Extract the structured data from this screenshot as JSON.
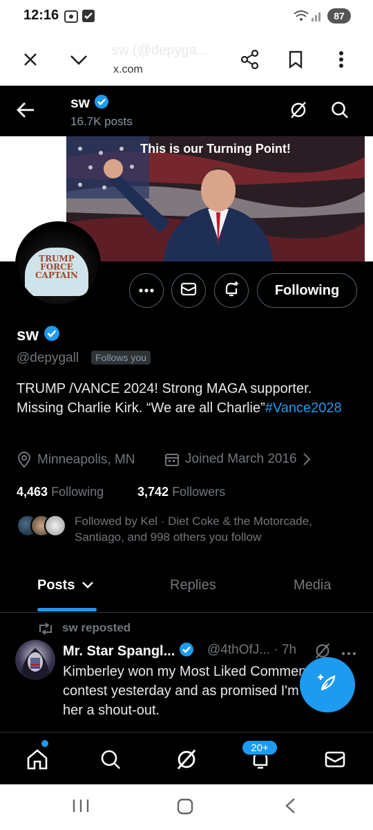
{
  "status_bar": {
    "time": "12:16",
    "battery": "87"
  },
  "browser": {
    "title": "sw (@depyga...",
    "url": "x.com"
  },
  "header": {
    "name": "sw",
    "posts": "16.7K posts"
  },
  "banner": {
    "caption": "This is our Turning Point!"
  },
  "avatar": {
    "cap_text": [
      "TRUMP",
      "FORCE",
      "CAPTAIN"
    ]
  },
  "profile": {
    "name": "sw",
    "handle": "@depygall",
    "follows_you": "Follows you",
    "bio_text": "TRUMP /VANCE 2024! Strong MAGA supporter. Missing Charlie Kirk. “We are all Charlie”",
    "bio_hashtag": "#Vance2028",
    "location": "Minneapolis, MN",
    "joined": "Joined March 2016",
    "following_count": "4,463",
    "following_label": "Following",
    "followers_count": "3,742",
    "followers_label": "Followers",
    "followed_by": "Followed by Kel · Diet Coke & the Motorcade, Santiago, and 998 others you follow"
  },
  "actions": {
    "follow_state": "Following"
  },
  "tabs": [
    {
      "label": "Posts",
      "active": true
    },
    {
      "label": "Replies",
      "active": false
    },
    {
      "label": "Media",
      "active": false
    }
  ],
  "post": {
    "repost_label": "sw reposted",
    "author": "Mr. Star Spangl...",
    "handle_time": "@4thOfJ... · 7h",
    "text": "Kimberley won my Most Liked Comment contest yesterday and as promised I'm giving her a shout-out."
  },
  "bottom_nav": {
    "notifications_badge": "20+"
  },
  "colors": {
    "accent": "#1d9bf0",
    "background": "#000000",
    "muted": "#71767b"
  }
}
